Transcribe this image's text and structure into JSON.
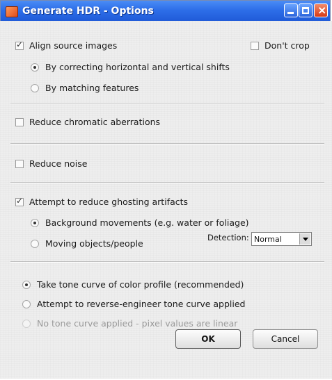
{
  "window": {
    "title": "Generate HDR - Options"
  },
  "options": {
    "align_source_images": "Align source images",
    "dont_crop": "Don't crop",
    "by_correcting_shifts": "By correcting horizontal and vertical shifts",
    "by_matching_features": "By matching features",
    "reduce_chromatic_aberrations": "Reduce chromatic aberrations",
    "reduce_noise": "Reduce noise",
    "attempt_reduce_ghosting": "Attempt to reduce ghosting artifacts",
    "background_movements": "Background movements (e.g. water or foliage)",
    "moving_objects_people": "Moving objects/people",
    "detection_label": "Detection:",
    "detection_value": "Normal",
    "take_tone_curve": "Take tone curve of color profile (recommended)",
    "reverse_engineer_tone_curve": "Attempt to reverse-engineer tone curve applied",
    "no_tone_curve": "No tone curve applied - pixel values are linear"
  },
  "buttons": {
    "ok": "OK",
    "cancel": "Cancel"
  }
}
